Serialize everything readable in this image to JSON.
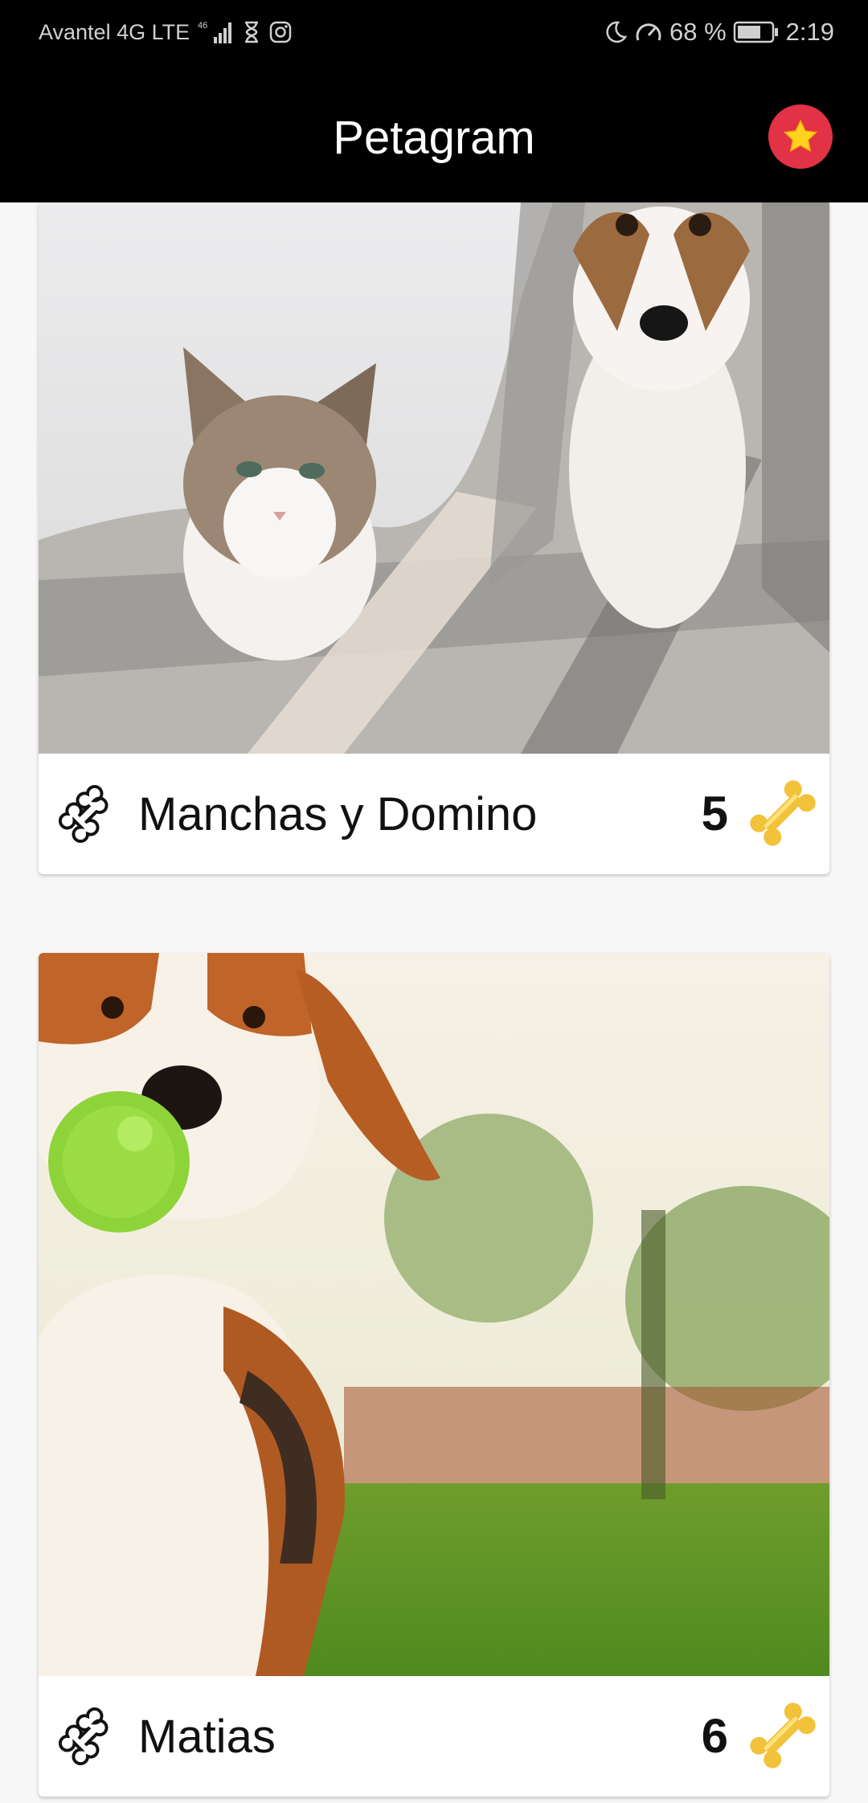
{
  "status_bar": {
    "carrier": "Avantel 4G LTE",
    "network_badge": "46",
    "battery_percent": "68 %",
    "time": "2:19",
    "icons": [
      "signal-icon",
      "hourglass-icon",
      "instagram-icon",
      "moon-icon",
      "speed-icon",
      "battery-icon"
    ]
  },
  "app_bar": {
    "title": "Petagram",
    "action_icon": "star-icon",
    "action_color": "#e23245"
  },
  "pets": [
    {
      "name": "Manchas y Domino",
      "likes": "5",
      "photo": "cat and dog under blanket",
      "like_icon": "bone-outline-icon",
      "rating_icon": "bone-gold-icon"
    },
    {
      "name": "Matias",
      "likes": "6",
      "photo": "beagle with green ball",
      "like_icon": "bone-outline-icon",
      "rating_icon": "bone-gold-icon"
    }
  ],
  "colors": {
    "app_bar_bg": "#000000",
    "page_bg": "#f7f7f7",
    "bone_gold": "#f2c23a"
  }
}
